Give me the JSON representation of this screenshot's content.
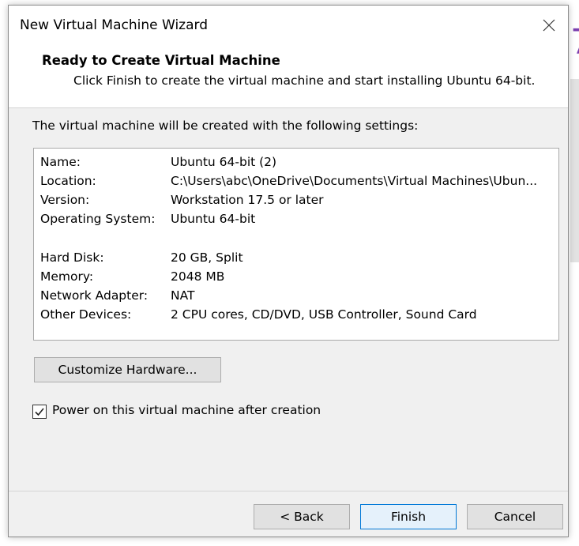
{
  "dialog": {
    "title": "New Virtual Machine Wizard",
    "header_title": "Ready to Create Virtual Machine",
    "header_subtitle": "Click Finish to create the virtual machine and start installing Ubuntu 64-bit."
  },
  "body": {
    "intro": "The virtual machine will be created with the following settings:",
    "settings": [
      {
        "key": "Name:",
        "value": "Ubuntu 64-bit (2)"
      },
      {
        "key": "Location:",
        "value": "C:\\Users\\abc\\OneDrive\\Documents\\Virtual Machines\\Ubun..."
      },
      {
        "key": "Version:",
        "value": "Workstation 17.5 or later"
      },
      {
        "key": "Operating System:",
        "value": "Ubuntu 64-bit"
      },
      {
        "key": "Hard Disk:",
        "value": "20 GB, Split"
      },
      {
        "key": "Memory:",
        "value": "2048 MB"
      },
      {
        "key": "Network Adapter:",
        "value": "NAT"
      },
      {
        "key": "Other Devices:",
        "value": "2 CPU cores, CD/DVD, USB Controller, Sound Card"
      }
    ],
    "customize_label": "Customize Hardware...",
    "power_on_label": "Power on this virtual machine after creation",
    "power_on_checked": true
  },
  "footer": {
    "back_label": "< Back",
    "finish_label": "Finish",
    "cancel_label": "Cancel"
  },
  "colors": {
    "accent": "#0078d7",
    "background_app_accent": "#7b3fb0"
  },
  "icons": {
    "close": "close-icon",
    "check": "checkmark-icon"
  }
}
